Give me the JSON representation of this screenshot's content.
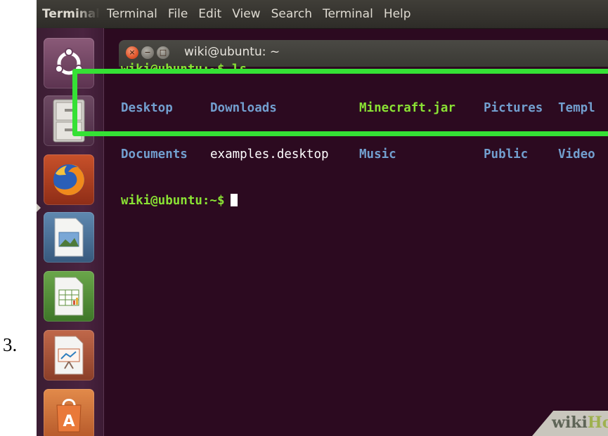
{
  "step": {
    "number": "3."
  },
  "menubar": {
    "app_title": "Terminal",
    "items": [
      "Terminal",
      "File",
      "Edit",
      "View",
      "Search",
      "Terminal",
      "Help"
    ]
  },
  "launcher": {
    "items": [
      {
        "name": "ubuntu-dash",
        "icon": "ubuntu-logo-icon"
      },
      {
        "name": "files",
        "icon": "file-cabinet-icon"
      },
      {
        "name": "firefox",
        "icon": "firefox-icon"
      },
      {
        "name": "libreoffice-impress-image",
        "icon": "image-document-icon"
      },
      {
        "name": "libreoffice-calc",
        "icon": "spreadsheet-icon"
      },
      {
        "name": "libreoffice-impress",
        "icon": "presentation-icon"
      },
      {
        "name": "software-center",
        "icon": "shopping-bag-icon"
      }
    ]
  },
  "window": {
    "title": "wiki@ubuntu: ~",
    "controls": [
      "close",
      "minimize",
      "maximize"
    ]
  },
  "terminal": {
    "previous_line": "wiki@ubuntu:~$ ls",
    "listing": [
      [
        {
          "text": "Desktop",
          "kind": "dir"
        },
        {
          "text": "Downloads",
          "kind": "dir"
        },
        {
          "text": "Minecraft.jar",
          "kind": "exec"
        },
        {
          "text": "Pictures",
          "kind": "dir"
        },
        {
          "text": "Templ",
          "kind": "dir"
        }
      ],
      [
        {
          "text": "Documents",
          "kind": "dir"
        },
        {
          "text": "examples.desktop",
          "kind": "file"
        },
        {
          "text": "Music",
          "kind": "dir"
        },
        {
          "text": "Public",
          "kind": "dir"
        },
        {
          "text": "Video",
          "kind": "dir"
        }
      ]
    ],
    "prompt": "wiki@ubuntu:~$"
  },
  "colors": {
    "terminal_bg": "#2c0a20",
    "dir": "#729fcf",
    "exec": "#8ae234",
    "prompt": "#8ae234",
    "highlight": "#35e135"
  },
  "watermark": {
    "wiki": "wiki",
    "how": "How"
  }
}
